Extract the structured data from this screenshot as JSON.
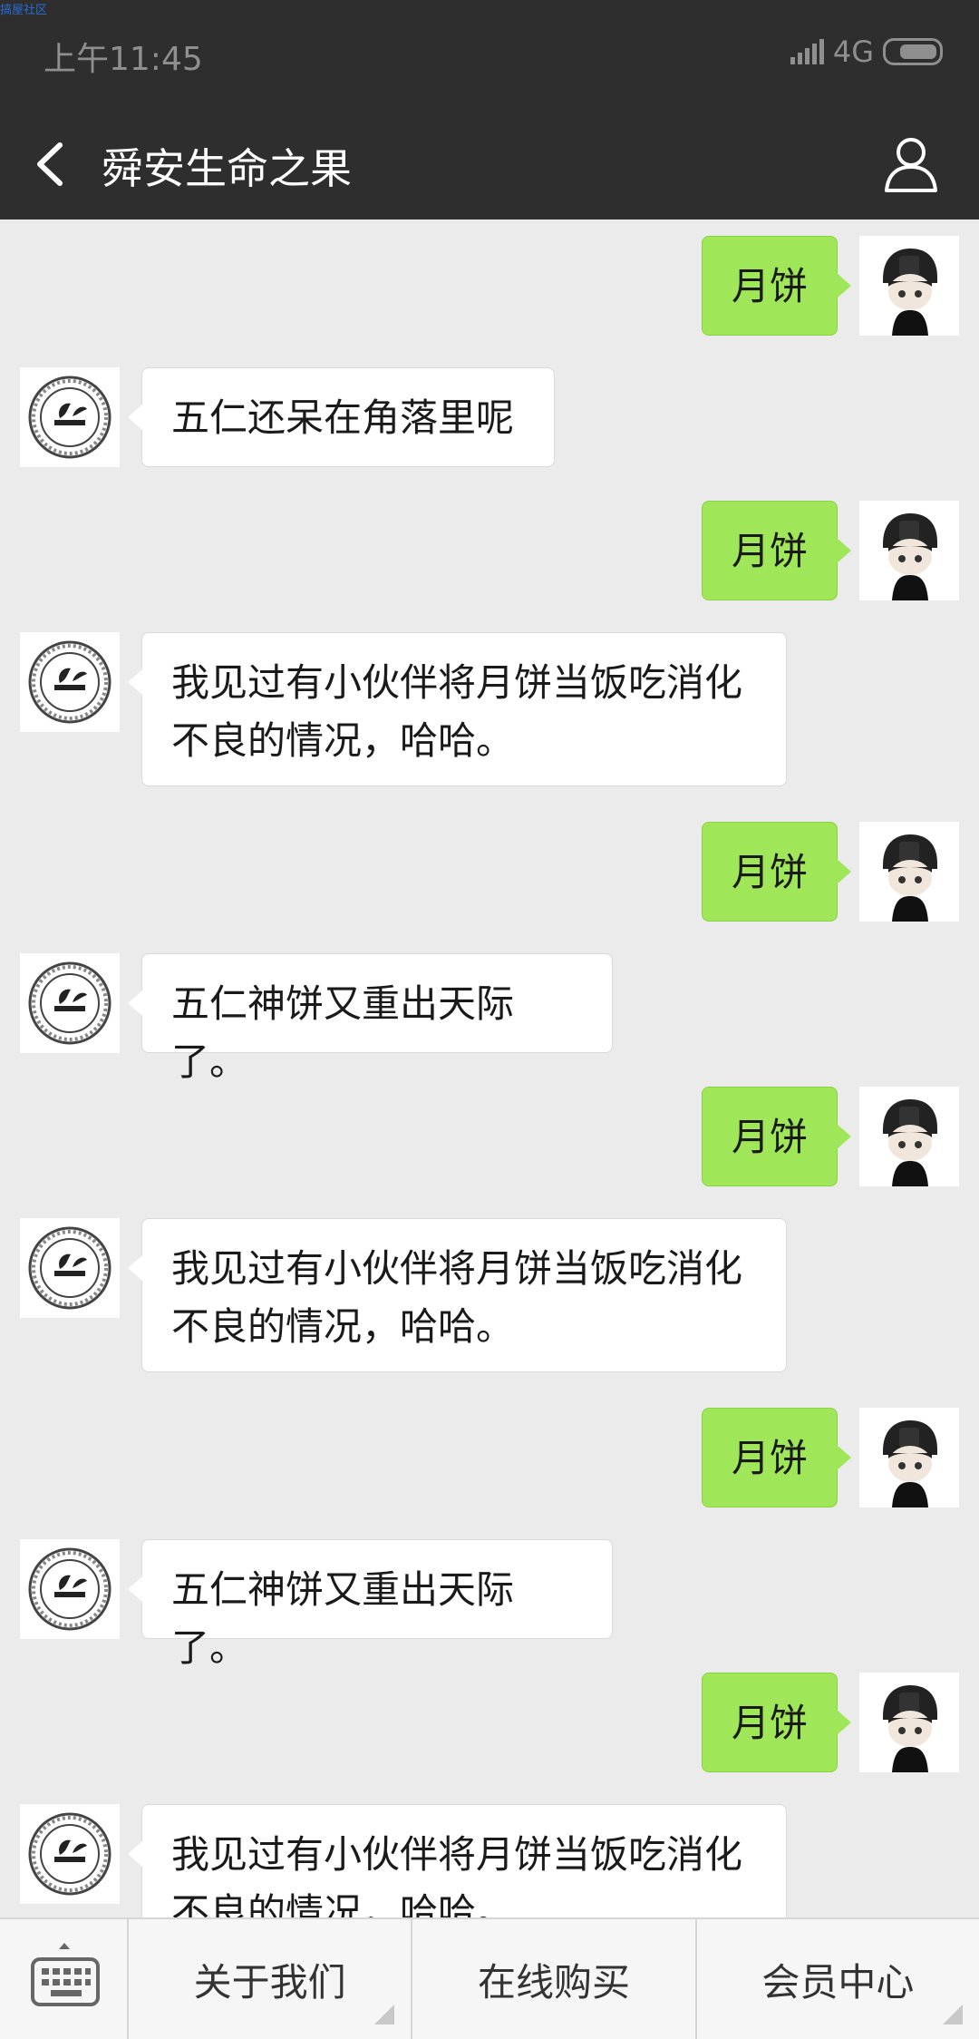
{
  "watermark": "搞屋社区",
  "status_bar": {
    "time": "上午11:45",
    "network": "4G"
  },
  "nav": {
    "title": "舜安生命之果",
    "back_icon": "chevron-left-icon",
    "profile_icon": "user-icon"
  },
  "colors": {
    "nav_bg": "#2e2e2e",
    "chat_bg": "#ebebeb",
    "sent_bubble": "#9fe758",
    "received_bubble": "#ffffff"
  },
  "messages": [
    {
      "side": "right",
      "text": "月饼"
    },
    {
      "side": "left",
      "text": "五仁还呆在角落里呢"
    },
    {
      "side": "right",
      "text": "月饼"
    },
    {
      "side": "left",
      "text": "我见过有小伙伴将月饼当饭吃消化不良的情况，哈哈。"
    },
    {
      "side": "right",
      "text": "月饼"
    },
    {
      "side": "left",
      "text": "五仁神饼又重出天际了。"
    },
    {
      "side": "right",
      "text": "月饼"
    },
    {
      "side": "left",
      "text": "我见过有小伙伴将月饼当饭吃消化不良的情况，哈哈。"
    },
    {
      "side": "right",
      "text": "月饼"
    },
    {
      "side": "left",
      "text": "五仁神饼又重出天际了。"
    },
    {
      "side": "right",
      "text": "月饼"
    },
    {
      "side": "left",
      "text": "我见过有小伙伴将月饼当饭吃消化不良的情况，哈哈。"
    }
  ],
  "menu": {
    "keyboard_icon": "keyboard-icon",
    "items": [
      {
        "label": "关于我们"
      },
      {
        "label": "在线购买"
      },
      {
        "label": "会员中心"
      }
    ]
  }
}
